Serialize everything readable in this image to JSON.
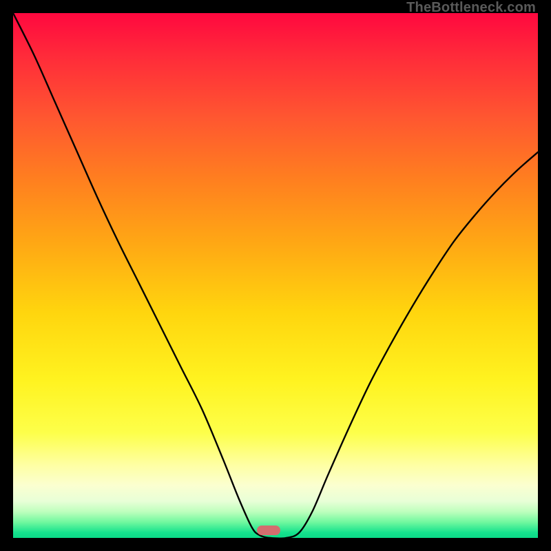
{
  "watermark": "TheBottleneck.com",
  "marker": {
    "x_frac": 0.487,
    "y_frac": 0.985
  },
  "chart_data": {
    "type": "line",
    "title": "",
    "xlabel": "",
    "ylabel": "",
    "xlim": [
      0,
      1
    ],
    "ylim": [
      0,
      1
    ],
    "series": [
      {
        "name": "bottleneck-curve",
        "x": [
          0.0,
          0.04,
          0.08,
          0.12,
          0.16,
          0.2,
          0.24,
          0.28,
          0.32,
          0.36,
          0.4,
          0.43,
          0.455,
          0.47,
          0.49,
          0.52,
          0.545,
          0.57,
          0.6,
          0.64,
          0.68,
          0.72,
          0.76,
          0.8,
          0.84,
          0.88,
          0.92,
          0.96,
          1.0
        ],
        "y": [
          1.0,
          0.92,
          0.83,
          0.74,
          0.65,
          0.565,
          0.485,
          0.405,
          0.325,
          0.245,
          0.15,
          0.075,
          0.02,
          0.005,
          0.0,
          0.0,
          0.01,
          0.05,
          0.12,
          0.21,
          0.295,
          0.37,
          0.44,
          0.505,
          0.565,
          0.615,
          0.66,
          0.7,
          0.735
        ]
      }
    ],
    "marker": {
      "x": 0.487,
      "y": 0.015
    },
    "legend": false,
    "grid": false
  }
}
